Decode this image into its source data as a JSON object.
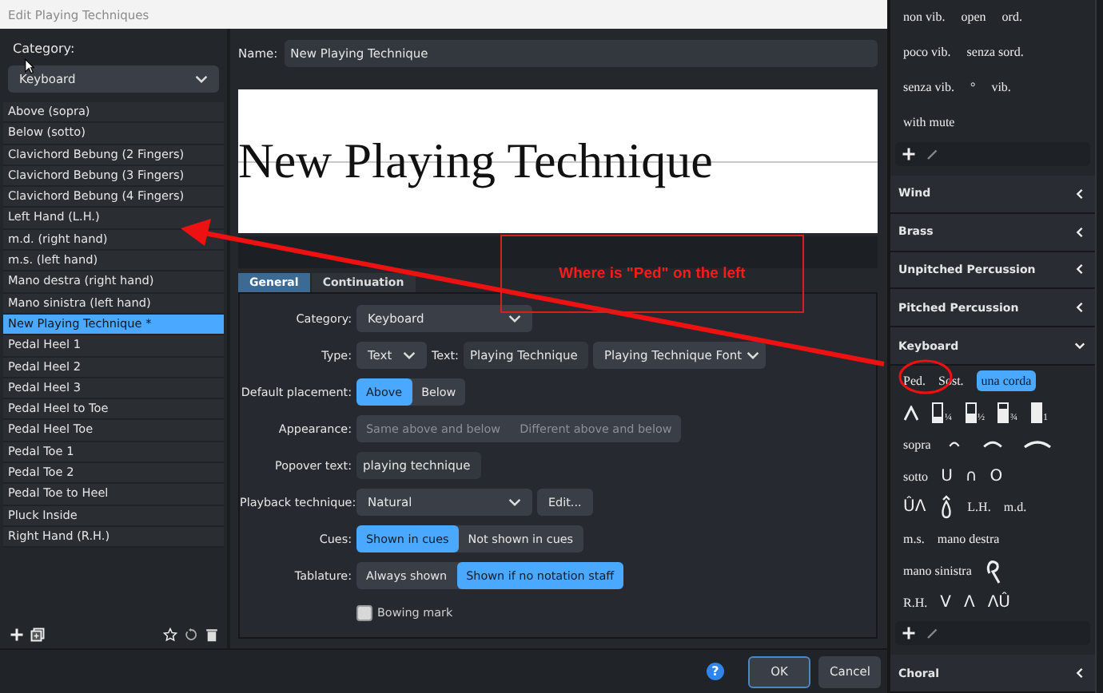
{
  "window": {
    "title": "Edit Playing Techniques"
  },
  "sidebar": {
    "category_label": "Category:",
    "category_value": "Keyboard",
    "items": [
      {
        "label": "Above (sopra)",
        "selected": false
      },
      {
        "label": "Below (sotto)",
        "selected": false
      },
      {
        "label": "Clavichord Bebung (2 Fingers)",
        "selected": false
      },
      {
        "label": "Clavichord Bebung (3 Fingers)",
        "selected": false
      },
      {
        "label": "Clavichord Bebung (4 Fingers)",
        "selected": false
      },
      {
        "label": "Left Hand (L.H.)",
        "selected": false
      },
      {
        "label": "m.d. (right hand)",
        "selected": false
      },
      {
        "label": "m.s. (left hand)",
        "selected": false
      },
      {
        "label": "Mano destra (right hand)",
        "selected": false
      },
      {
        "label": "Mano sinistra (left hand)",
        "selected": false
      },
      {
        "label": "New Playing Technique *",
        "selected": true
      },
      {
        "label": "Pedal Heel 1",
        "selected": false
      },
      {
        "label": "Pedal Heel 2",
        "selected": false
      },
      {
        "label": "Pedal Heel 3",
        "selected": false
      },
      {
        "label": "Pedal Heel to Toe",
        "selected": false
      },
      {
        "label": "Pedal Heel Toe",
        "selected": false
      },
      {
        "label": "Pedal Toe 1",
        "selected": false
      },
      {
        "label": "Pedal Toe 2",
        "selected": false
      },
      {
        "label": "Pedal Toe to Heel",
        "selected": false
      },
      {
        "label": "Pluck Inside",
        "selected": false
      },
      {
        "label": "Right Hand (R.H.)",
        "selected": false
      }
    ]
  },
  "editor": {
    "name_label": "Name:",
    "name_value": "New Playing Technique",
    "preview_text": "New Playing Technique",
    "tabs": [
      {
        "label": "General",
        "selected": true
      },
      {
        "label": "Continuation",
        "selected": false
      }
    ],
    "rows": [
      {
        "kind": "dropdown",
        "label": "Category:",
        "value": "Keyboard"
      },
      {
        "kind": "type",
        "label": "Type:",
        "value": "Text",
        "text_label": "Text:",
        "text_value": "Playing Technique",
        "font": "Playing Technique Font"
      },
      {
        "kind": "segmented",
        "label": "Default placement:",
        "disabled": false,
        "options": [
          {
            "label": "Above",
            "selected": true
          },
          {
            "label": "Below",
            "selected": false
          }
        ]
      },
      {
        "kind": "segmented",
        "label": "Appearance:",
        "disabled": true,
        "options": [
          {
            "label": "Same above and below",
            "selected": false
          },
          {
            "label": "Different above and below",
            "selected": false
          }
        ]
      },
      {
        "kind": "text",
        "label": "Popover text:",
        "value": "playing technique"
      },
      {
        "kind": "dropdown-edit",
        "label": "Playback technique:",
        "value": "Natural",
        "button": "Edit..."
      },
      {
        "kind": "segmented",
        "label": "Cues:",
        "disabled": false,
        "options": [
          {
            "label": "Shown in cues",
            "selected": true
          },
          {
            "label": "Not shown in cues",
            "selected": false
          }
        ]
      },
      {
        "kind": "segmented",
        "label": "Tablature:",
        "disabled": false,
        "options": [
          {
            "label": "Always shown",
            "selected": false
          },
          {
            "label": "Shown if no notation staff",
            "selected": true
          }
        ]
      },
      {
        "kind": "checkbox",
        "label": "Bowing mark",
        "checked": false
      }
    ]
  },
  "footer": {
    "help": "?",
    "buttons": [
      "OK",
      "Cancel"
    ]
  },
  "annotation": {
    "text": "Where is \"Ped\" on the left"
  },
  "palette": {
    "top_rows": [
      [
        {
          "text": "non vib.",
          "selected": false
        },
        {
          "text": "open",
          "selected": false
        },
        {
          "text": "ord.",
          "selected": false
        }
      ],
      [
        {
          "text": "poco vib.",
          "selected": false
        },
        {
          "text": "senza sord.",
          "selected": false
        }
      ],
      [
        {
          "text": "senza vib.",
          "selected": false
        },
        {
          "text": "°",
          "selected": false
        },
        {
          "text": "vib.",
          "selected": false
        }
      ],
      [
        {
          "text": "with mute",
          "selected": false
        }
      ]
    ],
    "sections": [
      {
        "title": "Wind",
        "expanded": false
      },
      {
        "title": "Brass",
        "expanded": false
      },
      {
        "title": "Unpitched Percussion",
        "expanded": false
      },
      {
        "title": "Pitched Percussion",
        "expanded": false
      },
      {
        "title": "Keyboard",
        "expanded": true,
        "rows": [
          [
            {
              "kind": "text",
              "text": "Ped.",
              "selected": false
            },
            {
              "kind": "text",
              "text": "Sost.",
              "selected": false
            },
            {
              "kind": "text",
              "text": "una corda",
              "selected": true
            }
          ],
          [
            {
              "kind": "caret",
              "selected": false
            },
            {
              "kind": "pedal-gauge",
              "level": 0.25,
              "label": "¼",
              "selected": false
            },
            {
              "kind": "pedal-gauge",
              "level": 0.5,
              "label": "½",
              "selected": false
            },
            {
              "kind": "pedal-gauge",
              "level": 0.75,
              "label": "¾",
              "selected": false
            },
            {
              "kind": "pedal-gauge",
              "level": 1,
              "label": "1",
              "selected": false
            }
          ],
          [
            {
              "kind": "text",
              "text": "sopra",
              "selected": false
            },
            {
              "kind": "arc",
              "selected": false
            },
            {
              "kind": "arc",
              "selected": false
            },
            {
              "kind": "arc",
              "selected": false
            }
          ],
          [
            {
              "kind": "text",
              "text": "sotto",
              "selected": false
            },
            {
              "kind": "glyph",
              "text": "U",
              "selected": false
            },
            {
              "kind": "glyph",
              "text": "∩",
              "selected": false
            },
            {
              "kind": "glyph",
              "text": "O",
              "selected": false
            }
          ],
          [
            {
              "kind": "glyph",
              "text": "ÛΛ",
              "selected": false
            },
            {
              "kind": "drop",
              "selected": false
            },
            {
              "kind": "text",
              "text": "L.H.",
              "selected": false
            },
            {
              "kind": "text",
              "text": "m.d.",
              "selected": false
            }
          ],
          [
            {
              "kind": "text",
              "text": "m.s.",
              "selected": false
            },
            {
              "kind": "text",
              "text": "mano destra",
              "selected": false
            }
          ],
          [
            {
              "kind": "text",
              "text": "mano sinistra",
              "selected": false
            },
            {
              "kind": "hook",
              "selected": false
            }
          ],
          [
            {
              "kind": "text",
              "text": "R.H.",
              "selected": false
            },
            {
              "kind": "glyph",
              "text": "V",
              "selected": false
            },
            {
              "kind": "glyph",
              "text": "Λ",
              "selected": false
            },
            {
              "kind": "glyph",
              "text": "ΛÛ",
              "selected": false
            }
          ]
        ]
      },
      {
        "title": "Choral",
        "expanded": false
      }
    ]
  }
}
